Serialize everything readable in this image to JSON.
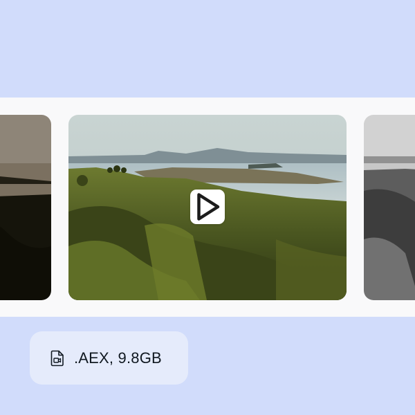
{
  "gallery": {
    "items": [
      {
        "position": "previous",
        "tone": "blue-tinted"
      },
      {
        "position": "current",
        "tone": "color",
        "has_play_button": true
      },
      {
        "position": "next",
        "tone": "grayscale"
      }
    ],
    "play_icon": "play-icon"
  },
  "file_info": {
    "icon": "video-file-icon",
    "label": ".AEX, 9.8GB"
  },
  "colors": {
    "background": "#d1dcfb",
    "strip": "#f9f9fa",
    "chip": "#e5ebfb",
    "text": "#101820"
  }
}
